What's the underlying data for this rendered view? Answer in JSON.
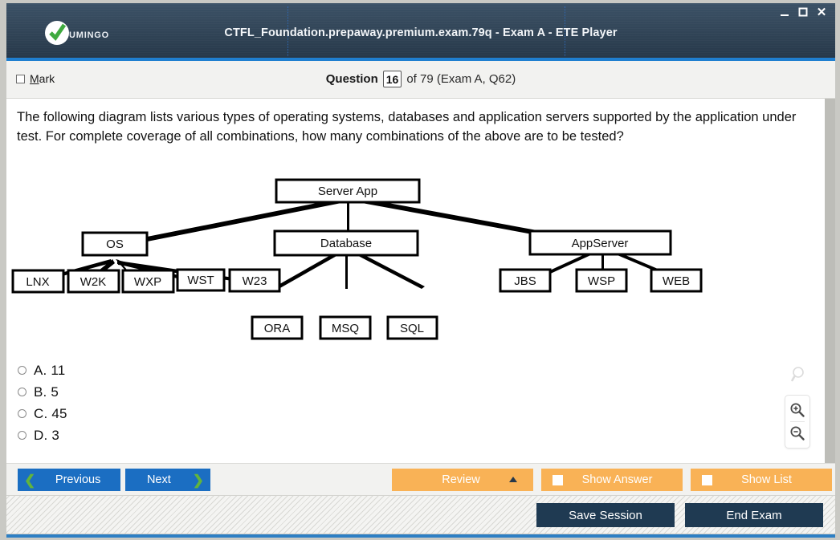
{
  "window": {
    "title": "CTFL_Foundation.prepaway.premium.exam.79q - Exam A - ETE Player",
    "logo_text": "UMINGO",
    "controls": {
      "minimize": "minimize-icon",
      "maximize": "maximize-icon",
      "close": "✕"
    },
    "accent_blue": "#1f7fd0",
    "titlebar_dark": "#35495c"
  },
  "question_header": {
    "mark_label_accel": "M",
    "mark_label_rest": "ark",
    "question_word": "Question",
    "question_number": "16",
    "of_text": "of 79 (Exam A, Q62)"
  },
  "question": {
    "text": "The following diagram lists various types of operating systems, databases and application servers supported by the application under test. For complete coverage of all combinations, how many combinations of the above are to be tested?"
  },
  "diagram": {
    "nodes": {
      "root": "Server App",
      "os": "OS",
      "database": "Database",
      "appserver": "AppServer",
      "os_children": [
        "LNX",
        "W2K",
        "WXP",
        "WST",
        "W23"
      ],
      "db_children": [
        "ORA",
        "MSQ",
        "SQL"
      ],
      "app_children": [
        "JBS",
        "WSP",
        "WEB"
      ]
    }
  },
  "options": [
    {
      "label": "A. 11",
      "selected": false
    },
    {
      "label": "B. 5",
      "selected": false
    },
    {
      "label": "C. 45",
      "selected": false
    },
    {
      "label": "D. 3",
      "selected": false
    }
  ],
  "zoom_tools": {
    "ghost": "magnifier-icon",
    "zoom_in": "zoom-in-icon",
    "zoom_out": "zoom-out-icon"
  },
  "toolbar": {
    "previous_label": "Previous",
    "previous_chevron": "❮",
    "next_label": "Next",
    "next_chevron": "❯",
    "review_label": "Review",
    "show_answer_label": "Show Answer",
    "show_list_label": "Show List",
    "orange": "#f9b256",
    "blue": "#1b6ec2",
    "chevron_green": "#62b43c"
  },
  "footer": {
    "save_session_label": "Save Session",
    "end_exam_label": "End Exam",
    "dark": "#1f3a52"
  }
}
